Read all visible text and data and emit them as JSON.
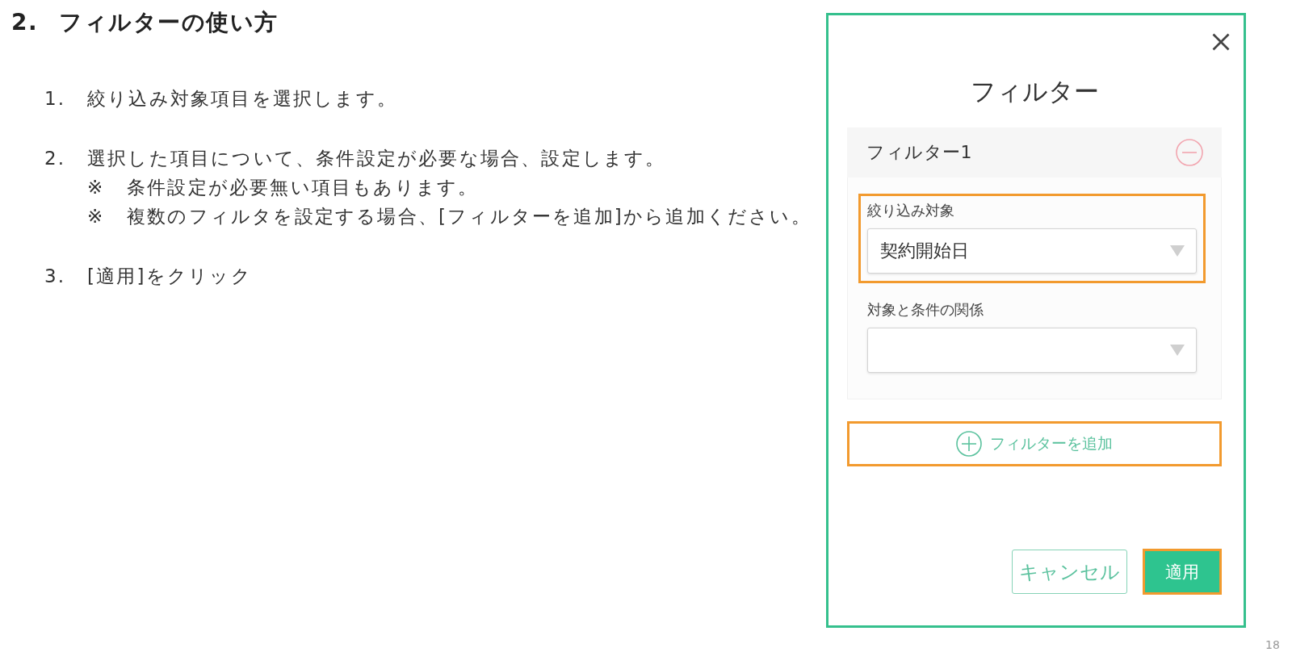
{
  "heading": {
    "number": "2.",
    "text": "フィルターの使い方"
  },
  "steps": [
    {
      "number": "1.",
      "text": "絞り込み対象項目を選択します。"
    },
    {
      "number": "2.",
      "text": "選択した項目について、条件設定が必要な場合、設定します。",
      "notes": [
        {
          "mark": "※",
          "text": "条件設定が必要無い項目もあります。"
        },
        {
          "mark": "※",
          "text": "複数のフィルタを設定する場合、[フィルターを追加]から追加ください。"
        }
      ]
    },
    {
      "number": "3.",
      "text": "[適用]をクリック"
    }
  ],
  "dialog": {
    "title": "フィルター",
    "filters": [
      {
        "title": "フィルター1",
        "fields": [
          {
            "label": "絞り込み対象",
            "value": "契約開始日",
            "highlighted": true
          },
          {
            "label": "対象と条件の関係",
            "highlighted": false
          }
        ]
      }
    ],
    "add_button": {
      "label": "フィルターを追加",
      "highlighted": true
    },
    "buttons": [
      {
        "label": "キャンセル",
        "kind": "secondary",
        "highlighted": false
      },
      {
        "label": "適用",
        "kind": "primary",
        "highlighted": true
      }
    ]
  },
  "page_number": "18"
}
